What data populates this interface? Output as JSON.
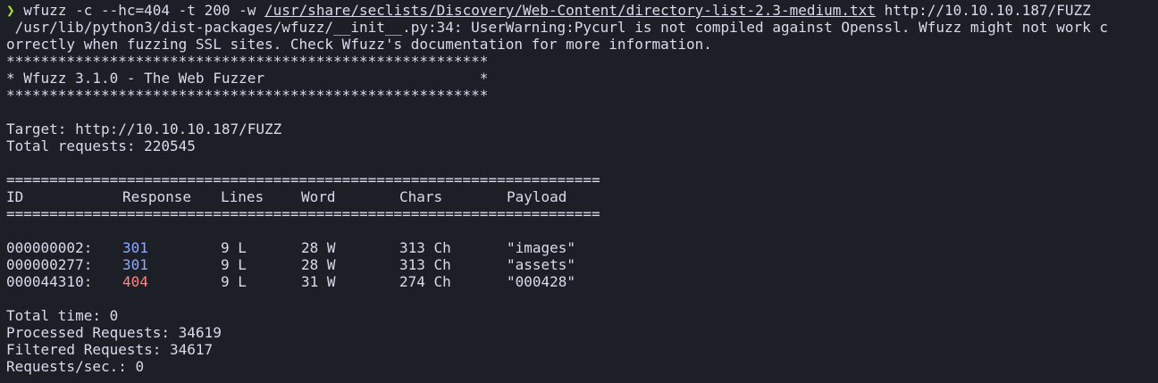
{
  "colors": {
    "background": "#1d1f27",
    "text": "#d8dcea",
    "prompt": "#a6e22e",
    "code_301": "#8fa8ff",
    "code_404": "#ff8484"
  },
  "command": {
    "prompt_symbol": "❯",
    "part1": "wfuzz -c --hc=404 -t 200 -w",
    "wordlist": "/usr/share/seclists/Discovery/Web-Content/directory-list-2.3-medium.txt",
    "url": "http://10.10.10.187/FUZZ"
  },
  "warning": {
    "line1": " /usr/lib/python3/dist-packages/wfuzz/__init__.py:34: UserWarning:Pycurl is not compiled against Openssl. Wfuzz might not work c",
    "line2": "orrectly when fuzzing SSL sites. Check Wfuzz's documentation for more information."
  },
  "banner": {
    "border": "********************************************************",
    "title": "* Wfuzz 3.1.0 - The Web Fuzzer                         *"
  },
  "target": {
    "target_line": "Target: http://10.10.10.187/FUZZ",
    "total_line": "Total requests: 220545"
  },
  "table": {
    "separator": "=====================================================================",
    "headers": {
      "id": "ID",
      "response": "Response",
      "lines": "Lines",
      "word": "Word",
      "chars": "Chars",
      "payload": "Payload"
    },
    "rows": [
      {
        "id": "000000002:",
        "response": "301",
        "lines": "9 L",
        "word": "28 W",
        "chars": "313 Ch",
        "payload": "\"images\""
      },
      {
        "id": "000000277:",
        "response": "301",
        "lines": "9 L",
        "word": "28 W",
        "chars": "313 Ch",
        "payload": "\"assets\""
      },
      {
        "id": "000044310:",
        "response": "404",
        "lines": "9 L",
        "word": "31 W",
        "chars": "274 Ch",
        "payload": "\"000428\""
      }
    ]
  },
  "summary": {
    "total_time": "Total time: 0",
    "processed": "Processed Requests: 34619",
    "filtered": "Filtered Requests: 34617",
    "rate": "Requests/sec.: 0"
  }
}
